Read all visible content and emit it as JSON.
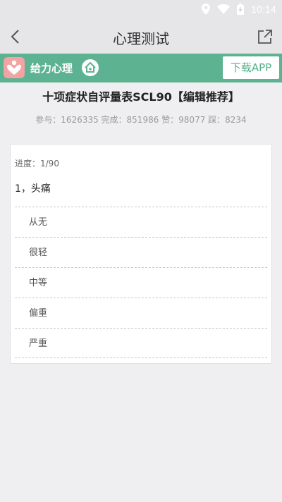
{
  "status": {
    "time": "10:14"
  },
  "appbar": {
    "title": "心理测试"
  },
  "banner": {
    "brand": "给力心理",
    "download": "下载APP"
  },
  "test": {
    "title": "十项症状自评量表SCL90【编辑推荐】",
    "stats": "参与：1626335 完成：851986 赞：98077 踩：8234"
  },
  "quiz": {
    "progress": "进度：1/90",
    "question": "1，头痛",
    "options": [
      "从无",
      "很轻",
      "中等",
      "偏重",
      "严重"
    ]
  },
  "colors": {
    "accent": "#5db391",
    "background": "#efeff2",
    "logo": "#f3a3a3"
  }
}
